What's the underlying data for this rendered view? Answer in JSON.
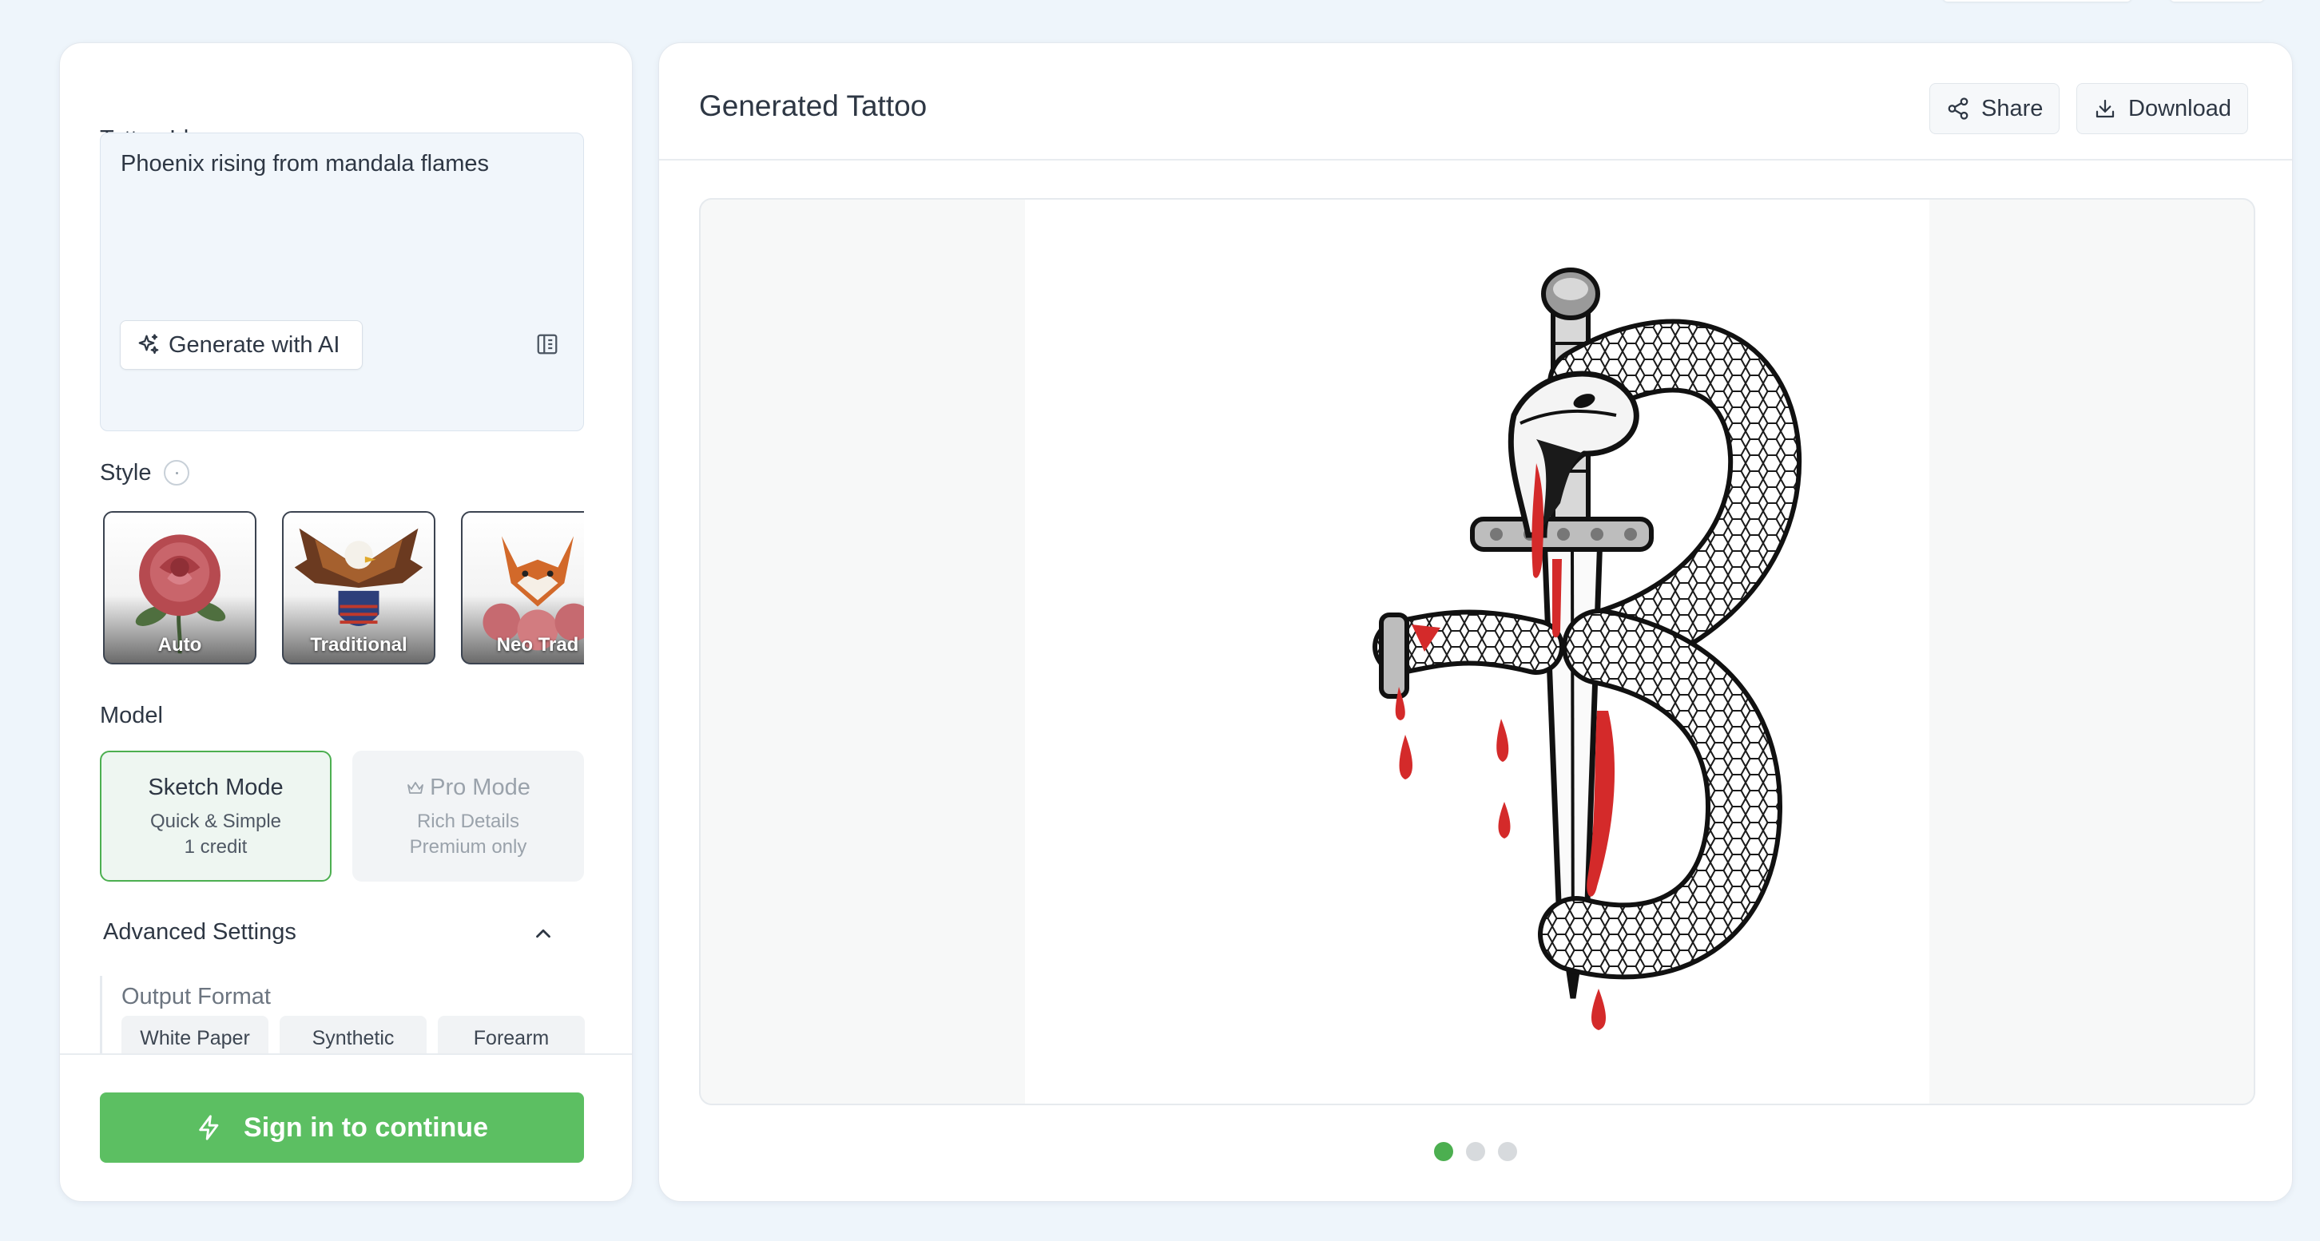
{
  "left_panel": {
    "tattoo_idea_label": "Tattoo Idea",
    "idea_value": "Phoenix rising from mandala flames",
    "generate_ai_label": "Generate with AI",
    "style_label": "Style",
    "styles": [
      {
        "label": "Auto",
        "icon": "rose-icon"
      },
      {
        "label": "Traditional",
        "icon": "eagle-icon"
      },
      {
        "label": "Neo Trad",
        "icon": "fox-icon"
      }
    ],
    "model_label": "Model",
    "models": [
      {
        "title": "Sketch Mode",
        "line1": "Quick & Simple",
        "line2": "1 credit",
        "selected": true
      },
      {
        "title": "Pro Mode",
        "line1": "Rich Details",
        "line2": "Premium only",
        "selected": false,
        "icon": "crown-icon"
      }
    ],
    "advanced_settings_label": "Advanced Settings",
    "output_format_label": "Output Format",
    "output_formats": [
      "White Paper",
      "Synthetic Skin",
      "Forearm"
    ],
    "sign_in_label": "Sign in to continue"
  },
  "right_panel": {
    "title": "Generated Tattoo",
    "share_label": "Share",
    "download_label": "Download",
    "image_subject": "snake-dagger-tattoo",
    "pagination": {
      "total": 3,
      "active": 1
    }
  },
  "colors": {
    "accent_green": "#5cbf62",
    "selected_dot": "#4caf50",
    "blood_red": "#d42a2a",
    "background": "#eef5fb"
  }
}
